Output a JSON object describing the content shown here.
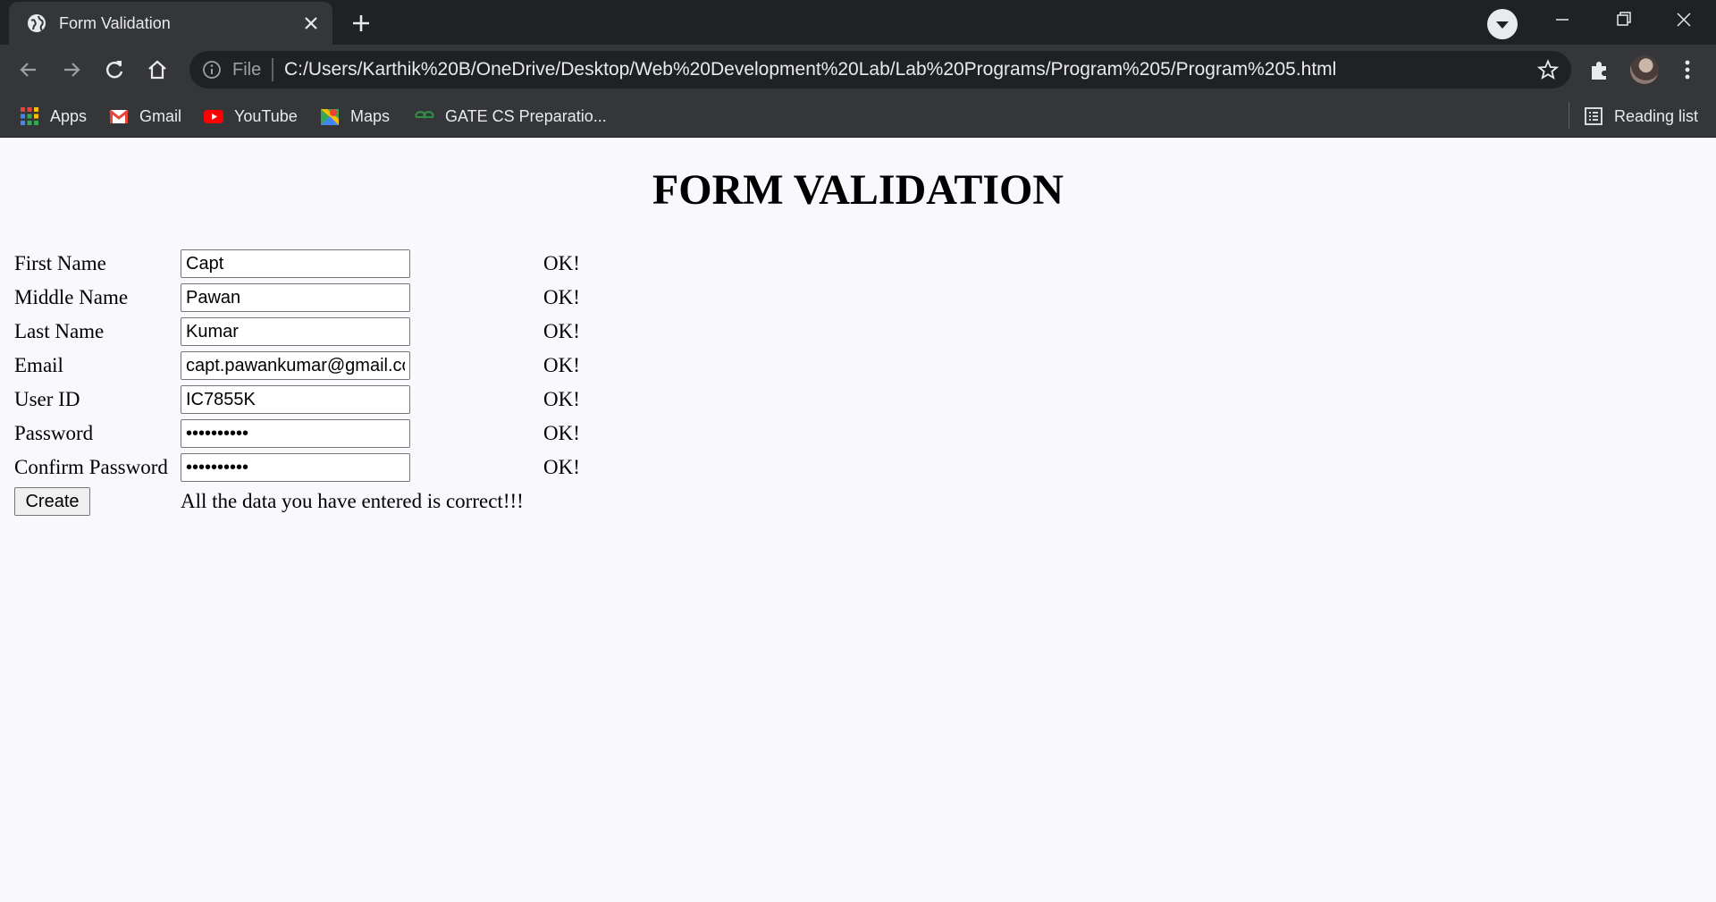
{
  "browser": {
    "tab_title": "Form Validation",
    "url_scheme_label": "File",
    "url": "C:/Users/Karthik%20B/OneDrive/Desktop/Web%20Development%20Lab/Lab%20Programs/Program%205/Program%205.html",
    "bookmarks": [
      {
        "label": "Apps",
        "icon": "apps-grid-icon"
      },
      {
        "label": "Gmail",
        "icon": "gmail-icon"
      },
      {
        "label": "YouTube",
        "icon": "youtube-icon"
      },
      {
        "label": "Maps",
        "icon": "maps-icon"
      },
      {
        "label": "GATE CS Preparatio...",
        "icon": "geeksforgeeks-icon"
      }
    ],
    "reading_list": "Reading list"
  },
  "page": {
    "title": "FORM VALIDATION",
    "fields": [
      {
        "label": "First Name",
        "value": "Capt",
        "status": "OK!"
      },
      {
        "label": "Middle Name",
        "value": "Pawan",
        "status": "OK!"
      },
      {
        "label": "Last Name",
        "value": "Kumar",
        "status": "OK!"
      },
      {
        "label": "Email",
        "value": "capt.pawankumar@gmail.com",
        "status": "OK!"
      },
      {
        "label": "User ID",
        "value": "IC7855K",
        "status": "OK!"
      },
      {
        "label": "Password",
        "value": "••••••••••",
        "status": "OK!"
      },
      {
        "label": "Confirm Password",
        "value": "••••••••••",
        "status": "OK!"
      }
    ],
    "create_label": "Create",
    "result_message": "All the data you have entered is correct!!!"
  }
}
